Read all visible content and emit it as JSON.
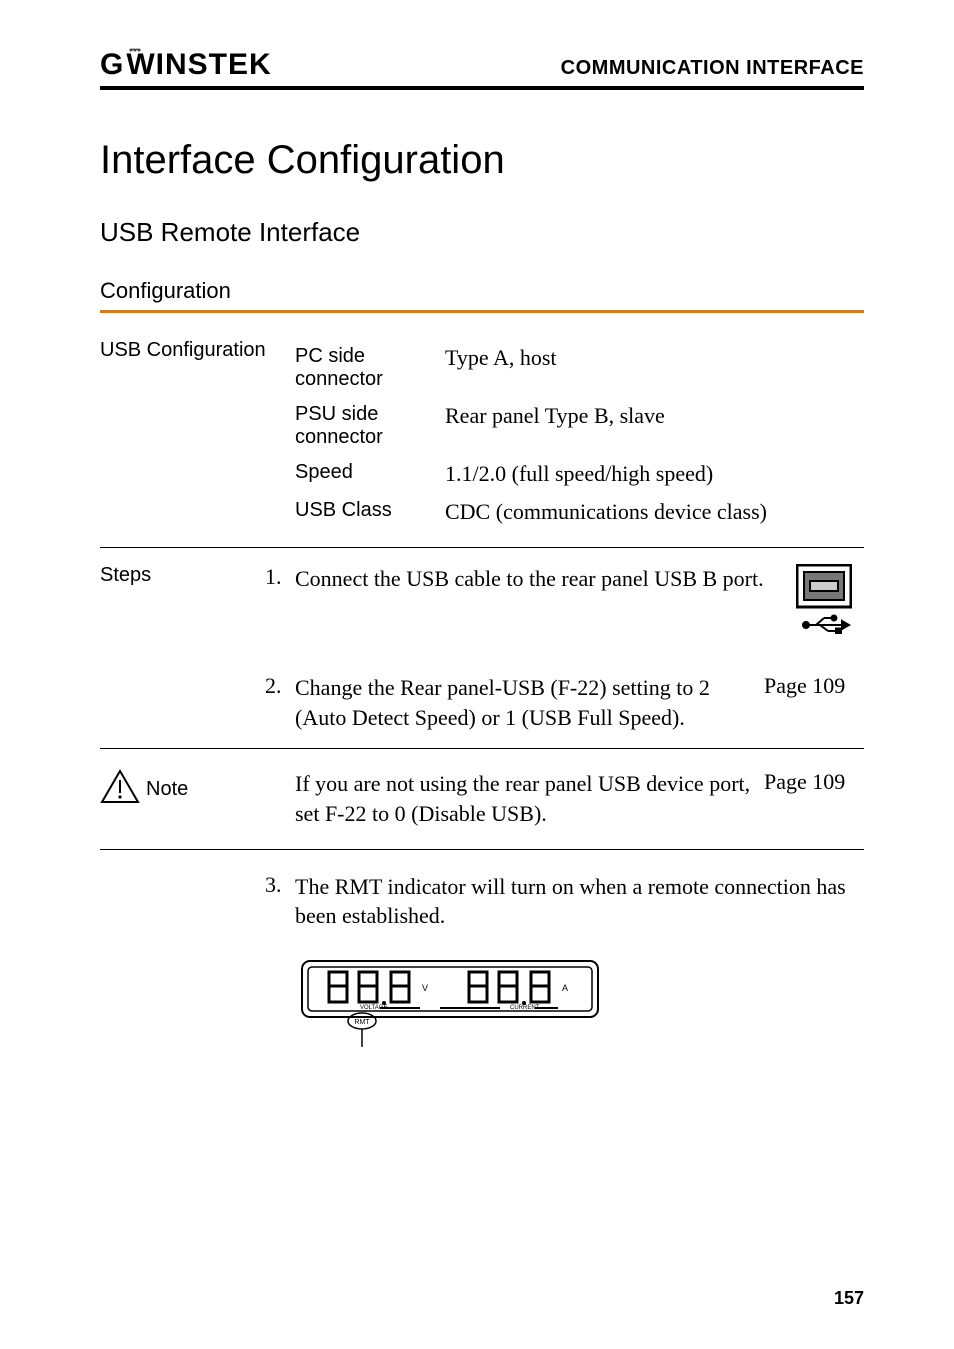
{
  "header": {
    "logo_text": "G",
    "logo_rest": "INSTEK",
    "right_text": "COMMUNICATION INTERFACE"
  },
  "title": "Interface Configuration",
  "section_title": "USB Remote Interface",
  "subsection_title": "Configuration",
  "usb_config": {
    "label": "USB Configuration",
    "rows": [
      {
        "key": "PC side connector",
        "value": "Type A, host"
      },
      {
        "key": "PSU side connector",
        "value": "Rear panel Type B, slave"
      },
      {
        "key": "Speed",
        "value": "1.1/2.0 (full speed/high speed)"
      },
      {
        "key": "USB Class",
        "value": "CDC (communications device class)"
      }
    ]
  },
  "steps": {
    "label": "Steps",
    "items": [
      {
        "num": "1.",
        "text": "Connect the USB cable to the rear panel USB B port.",
        "page_ref": ""
      },
      {
        "num": "2.",
        "text": "Change the Rear panel-USB (F-22) setting to 2 (Auto Detect Speed) or 1 (USB Full Speed).",
        "page_ref": "Page 109"
      }
    ],
    "item3": {
      "num": "3.",
      "text": "The RMT indicator will turn on when a remote connection has been established.",
      "page_ref": ""
    }
  },
  "note": {
    "label": "Note",
    "text": "If you are not using the rear panel USB device port, set F-22 to 0 (Disable USB).",
    "page_ref": "Page 109"
  },
  "rmt_display": {
    "voltage_label": "VOLTAGE",
    "current_label": "CURRENT",
    "v_unit": "V",
    "a_unit": "A",
    "rmt_badge": "RMT"
  },
  "page_number": "157"
}
